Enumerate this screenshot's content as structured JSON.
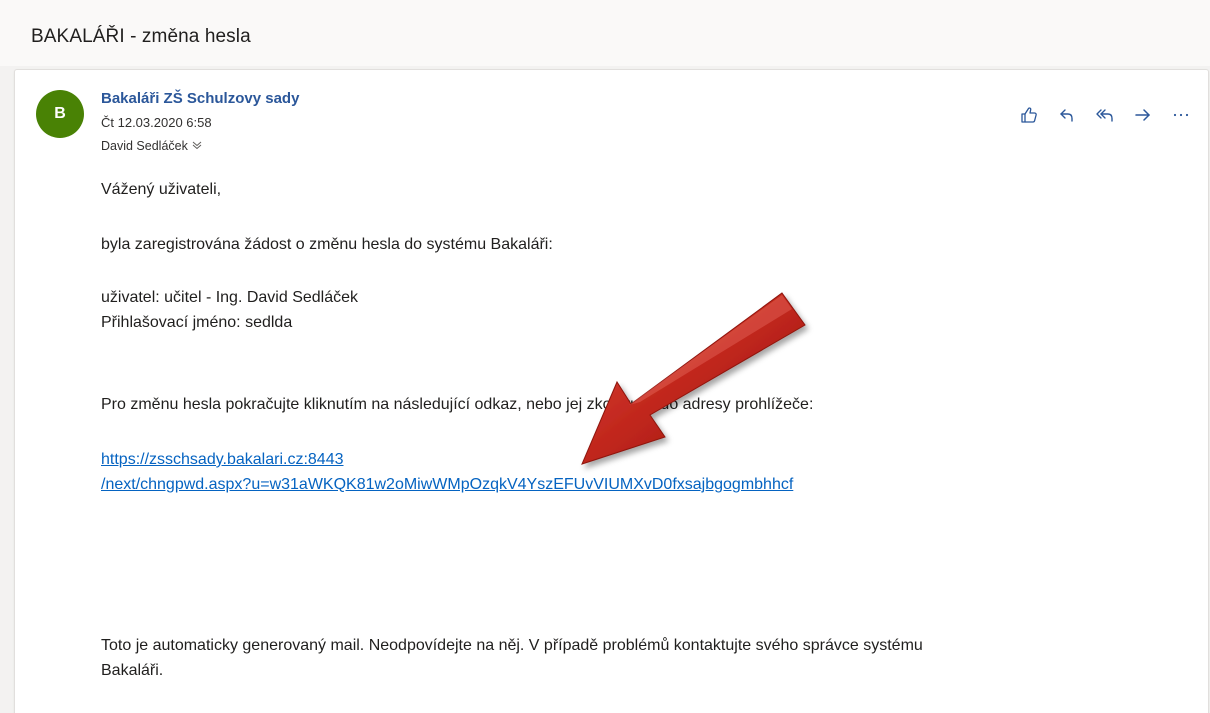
{
  "email": {
    "subject": "BAKALÁŘI - změna hesla",
    "sender": {
      "avatar_letter": "B",
      "avatar_color": "#498205",
      "name": "Bakaláři ZŠ Schulzovy sady",
      "date": "Čt 12.03.2020 6:58",
      "recipient": "David Sedláček"
    },
    "actions": [
      {
        "name": "like",
        "icon": "thumbs-up-icon"
      },
      {
        "name": "reply",
        "icon": "reply-icon"
      },
      {
        "name": "reply-all",
        "icon": "reply-all-icon"
      },
      {
        "name": "forward",
        "icon": "forward-icon"
      },
      {
        "name": "more",
        "icon": "more-icon"
      }
    ],
    "body": {
      "greeting": "Vážený uživateli,",
      "intro": "byla zaregistrována žádost o změnu hesla do systému Bakaláři:",
      "user_line": "uživatel: učitel - Ing. David Sedláček",
      "login_line": "Přihlašovací jméno: sedlda",
      "instruction": "Pro změnu hesla pokračujte kliknutím na následující odkaz, nebo jej zkopírujte do adresy prohlížeče:",
      "link_line1": "https://zsschsady.bakalari.cz:8443",
      "link_line2": "/next/chngpwd.aspx?u=w31aWKQK81w2oMiwWMpOzqkV4YszEFUvVIUMXvD0fxsajbgogmbhhcf",
      "footer_line1": "Toto je automaticky generovaný mail. Neodpovídejte na něj. V případě problémů kontaktujte svého správce systému",
      "footer_line2": "Bakaláři."
    }
  },
  "colors": {
    "accent": "#2b579a",
    "link": "#0563c1",
    "arrow": "#c0261c"
  }
}
